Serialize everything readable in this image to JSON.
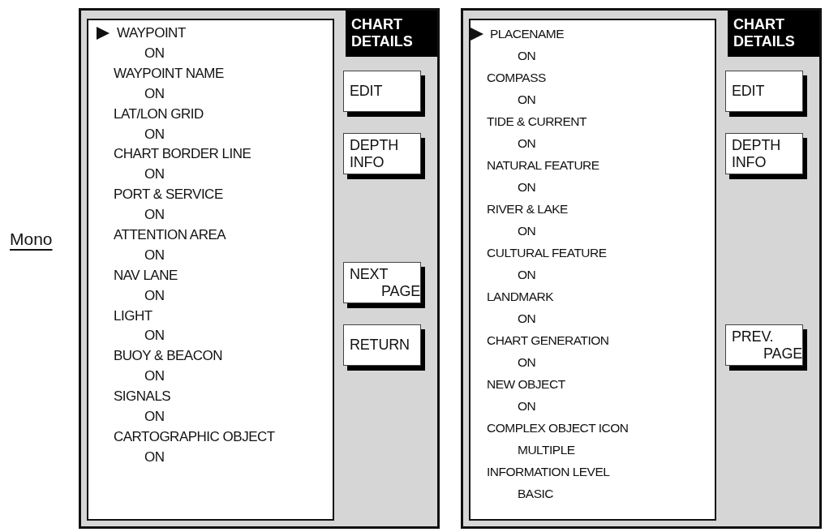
{
  "caption": "Mono",
  "screens": [
    {
      "title": "CHART DETAILS",
      "items": [
        {
          "label": "WAYPOINT",
          "value": "ON",
          "selected": true
        },
        {
          "label": "WAYPOINT NAME",
          "value": "ON",
          "selected": false
        },
        {
          "label": "LAT/LON GRID",
          "value": "ON",
          "selected": false
        },
        {
          "label": "CHART BORDER LINE",
          "value": "ON",
          "selected": false
        },
        {
          "label": "PORT & SERVICE",
          "value": "ON",
          "selected": false
        },
        {
          "label": "ATTENTION AREA",
          "value": "ON",
          "selected": false
        },
        {
          "label": "NAV LANE",
          "value": "ON",
          "selected": false
        },
        {
          "label": "LIGHT",
          "value": "ON",
          "selected": false
        },
        {
          "label": "BUOY & BEACON",
          "value": "ON",
          "selected": false
        },
        {
          "label": "SIGNALS",
          "value": "ON",
          "selected": false
        },
        {
          "label": "CARTOGRAPHIC OBJECT",
          "value": "ON",
          "selected": false
        }
      ],
      "soft_keys": [
        {
          "label": "EDIT",
          "kind": "option"
        },
        {
          "label": "DEPTH INFO",
          "kind": "option"
        },
        {
          "label": "NEXT PAGE",
          "kind": "page"
        },
        {
          "label": "RETURN",
          "kind": "back"
        }
      ]
    },
    {
      "title": "CHART DETAILS",
      "items": [
        {
          "label": "PLACENAME",
          "value": "ON",
          "selected": true
        },
        {
          "label": "COMPASS",
          "value": "ON",
          "selected": false
        },
        {
          "label": "TIDE & CURRENT",
          "value": "ON",
          "selected": false
        },
        {
          "label": "NATURAL FEATURE",
          "value": "ON",
          "selected": false
        },
        {
          "label": "RIVER & LAKE",
          "value": "ON",
          "selected": false
        },
        {
          "label": "CULTURAL FEATURE",
          "value": "ON",
          "selected": false
        },
        {
          "label": "LANDMARK",
          "value": "ON",
          "selected": false
        },
        {
          "label": "CHART GENERATION",
          "value": "ON",
          "selected": false
        },
        {
          "label": "NEW OBJECT",
          "value": "ON",
          "selected": false
        },
        {
          "label": "COMPLEX OBJECT ICON",
          "value": "MULTIPLE",
          "selected": false
        },
        {
          "label": "INFORMATION LEVEL",
          "value": "BASIC",
          "selected": false
        }
      ],
      "soft_keys": [
        {
          "label": "EDIT",
          "kind": "option"
        },
        {
          "label": "DEPTH INFO",
          "kind": "option"
        },
        {
          "label": "PREV. PAGE",
          "kind": "page"
        }
      ]
    }
  ]
}
